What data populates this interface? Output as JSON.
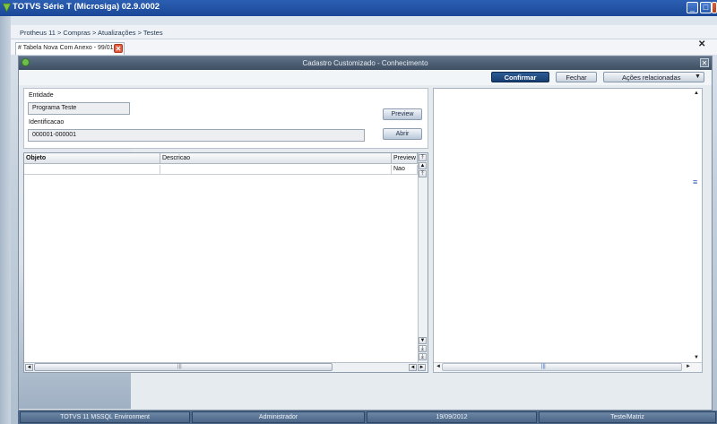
{
  "window": {
    "title": "TOTVS Série T  (Microsiga) 02.9.0002",
    "min_glyph": "_",
    "max_glyph": "□",
    "close_glyph": "✕"
  },
  "breadcrumb": "Protheus 11 > Compras  > Atualizações > Testes",
  "tab": {
    "label": "# Tabela Nova Com Anexo - 99/01",
    "close_glyph": "✕"
  },
  "workspace_close_glyph": "✕",
  "dialog": {
    "title": "Cadastro Customizado - Conhecimento",
    "close_glyph": "✕"
  },
  "toolbar": {
    "confirm": "Confirmar",
    "close": "Fechar",
    "related": "Ações relacionadas",
    "related_caret": "▼"
  },
  "form": {
    "entity_label": "Entidade",
    "entity_value": "Programa Teste",
    "id_label": "Identificacao",
    "id_value": "000001-000001",
    "preview_button": "Preview",
    "open_button": "Abrir"
  },
  "grid": {
    "headers": [
      "Objeto",
      "Descricao",
      "Preview"
    ],
    "rows": [
      {
        "objeto": "",
        "descricao": "",
        "preview": "Nao"
      }
    ]
  },
  "scroll_glyphs": {
    "top": "⤒",
    "up": "▲",
    "down": "▼",
    "bottom": "⤓",
    "left": "◄",
    "right": "►",
    "grip": "|||",
    "menu": "≡"
  },
  "status": {
    "environment": "TOTVS  11  MSSQL Environment",
    "user": "Administrador",
    "date": "19/09/2012",
    "branch": "Teste/Matriz"
  },
  "colors": {
    "title_bar": "#1b4797",
    "dialog_header": "#3e4f63",
    "primary_button": "#173d70",
    "status_bar": "#506b8c"
  }
}
